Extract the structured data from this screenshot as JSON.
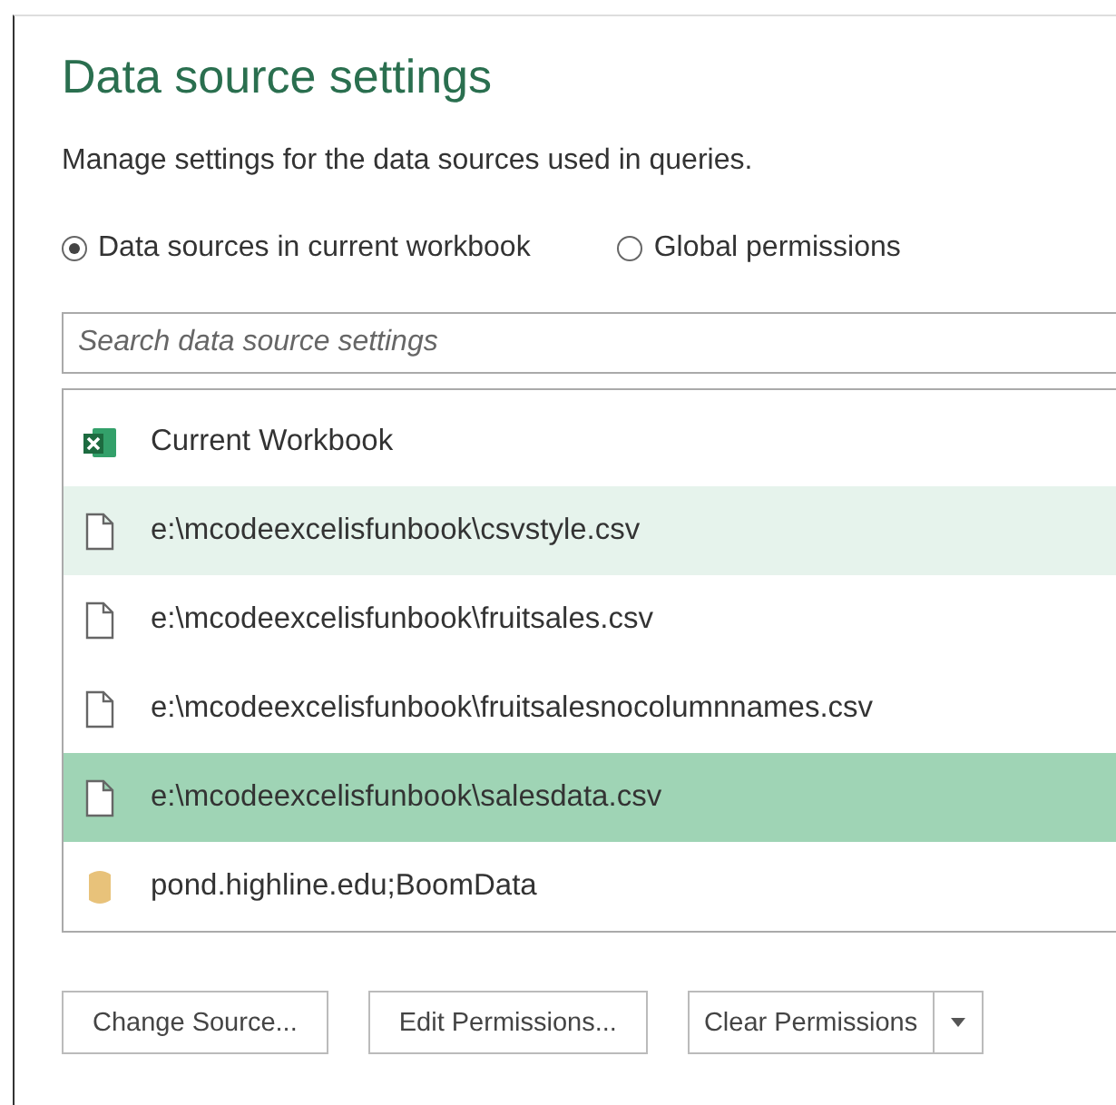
{
  "title": "Data source settings",
  "description": "Manage settings for the data sources used in queries.",
  "scope_options": [
    {
      "label": "Data sources in current workbook",
      "selected": true
    },
    {
      "label": "Global permissions",
      "selected": false
    }
  ],
  "search": {
    "placeholder": "Search data source settings"
  },
  "sources": [
    {
      "kind": "workbook",
      "label": "Current Workbook",
      "selected": false,
      "hovered": false
    },
    {
      "kind": "file",
      "label": "e:\\mcodeexcelisfunbook\\csvstyle.csv",
      "selected": false,
      "hovered": true
    },
    {
      "kind": "file",
      "label": "e:\\mcodeexcelisfunbook\\fruitsales.csv",
      "selected": false,
      "hovered": false
    },
    {
      "kind": "file",
      "label": "e:\\mcodeexcelisfunbook\\fruitsalesnocolumnnames.csv",
      "selected": false,
      "hovered": false
    },
    {
      "kind": "file",
      "label": "e:\\mcodeexcelisfunbook\\salesdata.csv",
      "selected": true,
      "hovered": false
    },
    {
      "kind": "database",
      "label": "pond.highline.edu;BoomData",
      "selected": false,
      "hovered": false
    }
  ],
  "buttons": [
    {
      "kind": "plain",
      "label": "Change Source..."
    },
    {
      "kind": "plain",
      "label": "Edit Permissions..."
    },
    {
      "kind": "split",
      "label": "Clear Permissions"
    }
  ]
}
